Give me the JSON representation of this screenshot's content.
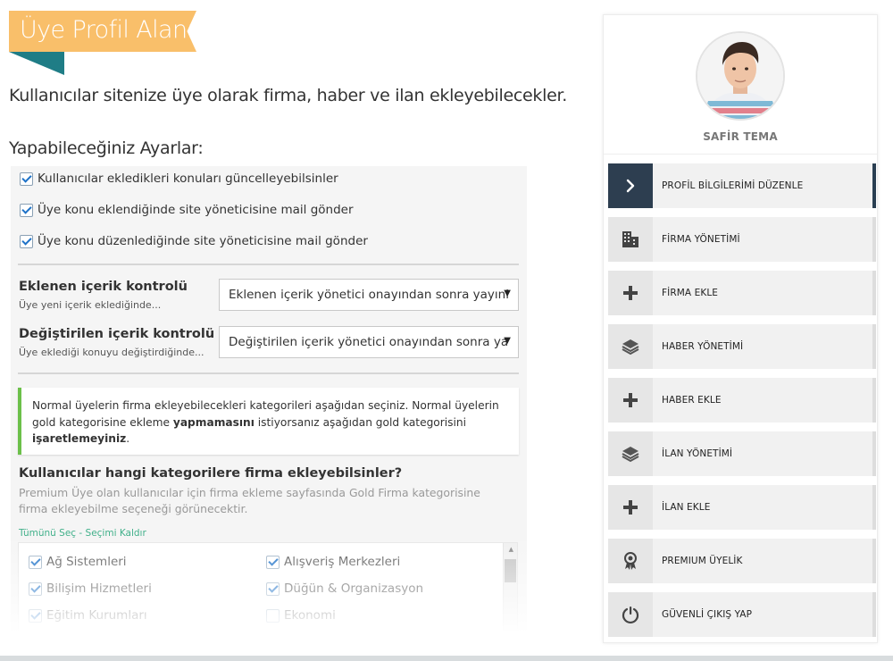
{
  "header": {
    "title": "Üye Profil Alanı",
    "lead": "Kullanıcılar sitenize üye olarak firma, haber ve ilan ekleyebilecekler.",
    "settings_title": "Yapabileceğiniz Ayarlar:"
  },
  "settings": {
    "checks": [
      {
        "label": "Kullanıcılar ekledikleri konuları güncelleyebilsinler",
        "checked": true
      },
      {
        "label": "Üye konu eklendiğinde site yöneticisine mail gönder",
        "checked": true
      },
      {
        "label": "Üye konu düzenlediğinde site yöneticisine mail gönder",
        "checked": true
      }
    ],
    "added_control": {
      "label": "Eklenen içerik kontrolü",
      "sub": "Üye yeni içerik eklediğinde...",
      "value": "Eklenen içerik yönetici onayından sonra yayınl"
    },
    "edited_control": {
      "label": "Değiştirilen içerik kontrolü",
      "sub": "Üye eklediği konuyu değiştirdiğinde...",
      "value": "Değiştirilen içerik yönetici onayından sonra ya"
    },
    "notice": {
      "part1": "Normal üyelerin firma ekleyebilecekleri kategorileri aşağıdan seçiniz. Normal üyelerin gold kategorisine ekleme ",
      "bold1": "yapmamasını",
      "part2": " istiyorsanız aşağıdan gold kategorisini ",
      "bold2": "işaretlemeyiniz",
      "part3": "."
    },
    "categories_question": "Kullanıcılar hangi kategorilere firma ekleyebilsinler?",
    "categories_desc": "Premium Üye olan kullanıcılar için firma ekleme sayfasında Gold Firma kategorisine firma ekleyebilme seçeneği görünecektir.",
    "select_all": "Tümünü Seç",
    "link_separator": " - ",
    "deselect_all": "Seçimi Kaldır",
    "categories": [
      {
        "label": "Ağ Sistemleri",
        "checked": true
      },
      {
        "label": "Alışveriş Merkezleri",
        "checked": true
      },
      {
        "label": "Bilişim Hizmetleri",
        "checked": true
      },
      {
        "label": "Düğün & Organizasyon",
        "checked": true
      },
      {
        "label": "Eğitim Kurumları",
        "checked": true
      },
      {
        "label": "Ekonomi",
        "checked": false
      }
    ]
  },
  "profile": {
    "name": "SAFİR TEMA"
  },
  "menu": [
    {
      "label": "PROFİL BİLGİLERİMİ DÜZENLE",
      "icon": "chevron-right-icon",
      "active": true
    },
    {
      "label": "FİRMA YÖNETİMİ",
      "icon": "building-icon",
      "active": false
    },
    {
      "label": "FİRMA EKLE",
      "icon": "plus-icon",
      "active": false
    },
    {
      "label": "HABER YÖNETİMİ",
      "icon": "layers-icon",
      "active": false
    },
    {
      "label": "HABER EKLE",
      "icon": "plus-icon",
      "active": false
    },
    {
      "label": "İLAN YÖNETİMİ",
      "icon": "layers-icon",
      "active": false
    },
    {
      "label": "İLAN EKLE",
      "icon": "plus-icon",
      "active": false
    },
    {
      "label": "PREMIUM ÜYELİK",
      "icon": "award-icon",
      "active": false
    },
    {
      "label": "GÜVENLİ ÇIKIŞ YAP",
      "icon": "power-icon",
      "active": false
    }
  ],
  "colors": {
    "ribbon": "#f9bf6a",
    "ribbon_fold": "#1f7d86",
    "notice_accent": "#6cc04a",
    "link": "#41b08a",
    "active_menu": "#2d3e50"
  }
}
